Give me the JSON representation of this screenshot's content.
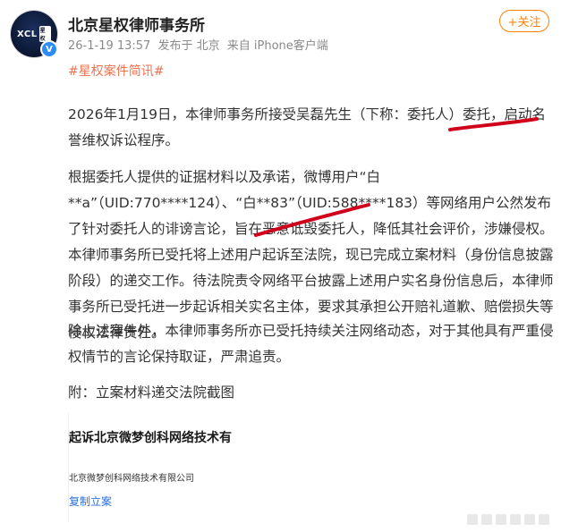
{
  "post": {
    "author_name": "北京星权律师事务所",
    "avatar_logo": "XCL",
    "avatar_logo_chip": "星权",
    "verified_badge": "V",
    "follow_label": "+关注",
    "meta": {
      "date": "26-1-19 13:57",
      "location": "发布于 北京",
      "source": "来自 iPhone客户端"
    },
    "topic": "#星权案件简讯#",
    "paragraphs": [
      "2026年1月19日，本律师事务所接受吴磊先生（下称：委托人）委托，启动名誉维权诉讼程序。",
      "根据委托人提供的证据材料以及承诺，微博用户“白**a”（UID:770****124）、“白**83”（UID:588****183）等网络用户公然发布了针对委托人的诽谤言论，旨在恶意诋毁委托人，降低其社会评价，涉嫌侵权。本律师事务所已受托将上述用户起诉至法院，现已完成立案材料（身份信息披露阶段）的递交工作。待法院责令网络平台披露上述用户实名身份信息后，本律师事务所已受托进一步起诉相关实名主体，要求其承担公开赔礼道歉、赔偿损失等侵权法律责任。",
      "除上述案件外，本律师事务所亦已受托持续关注网络动态，对于其他具有严重侵权情节的言论保持取证，严肃追责。",
      "附：立案材料递交法院截图"
    ],
    "attachment": {
      "title": "起诉北京微梦创科网络技术有",
      "company": "北京微梦创科网络技术有限公司",
      "link": "复制立案"
    },
    "colors": {
      "accent_orange": "#ff8200",
      "topic_color": "#eb7350",
      "annotation_red": "#d0021b",
      "link_blue": "#2b6fd6"
    }
  }
}
